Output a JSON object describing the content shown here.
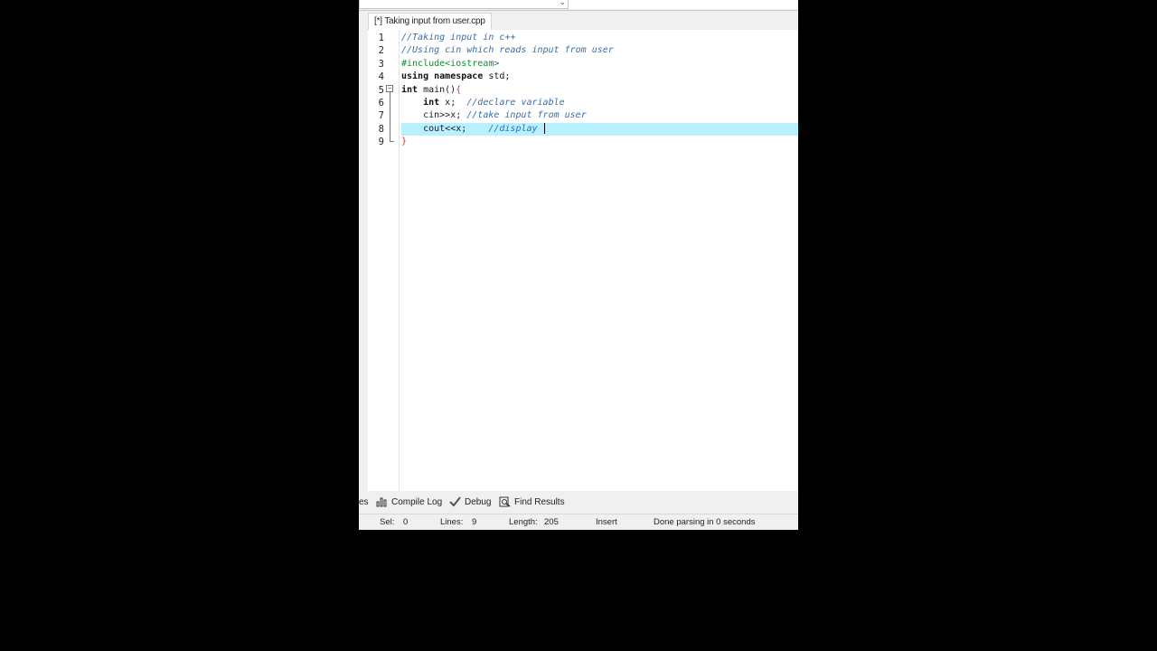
{
  "tab": {
    "title": "[*] Taking input from user.cpp"
  },
  "code": {
    "line_numbers": [
      "1",
      "2",
      "3",
      "4",
      "5",
      "6",
      "7",
      "8",
      "9"
    ],
    "lines": [
      {
        "comment": "//Taking input in c++"
      },
      {
        "comment": "//Using cin which reads input from user"
      },
      {
        "include": "#include<iostream>"
      },
      {
        "kw1": "using",
        "kw2": "namespace",
        "rest": " std;"
      },
      {
        "kw": "int",
        "rest": " main()",
        "brace": "{"
      },
      {
        "kw": "int",
        "rest": " x;  ",
        "comment": "//declare variable"
      },
      {
        "code": "cin>>x;",
        "comment": " //take input from user"
      },
      {
        "code": "cout<<x;",
        "comment": "    //display "
      },
      {
        "brace": "}"
      }
    ],
    "highlight_color": "#b9f0ff",
    "comment_color": "#2f6fb4"
  },
  "bottom_tabs": {
    "partial": "es",
    "compile_log": "Compile Log",
    "debug": "Debug",
    "find_results": "Find Results"
  },
  "status": {
    "sel_label": "Sel:",
    "sel_value": "0",
    "lines_label": "Lines:",
    "lines_value": "9",
    "length_label": "Length:",
    "length_value": "205",
    "mode": "Insert",
    "message": "Done parsing in 0 seconds"
  }
}
